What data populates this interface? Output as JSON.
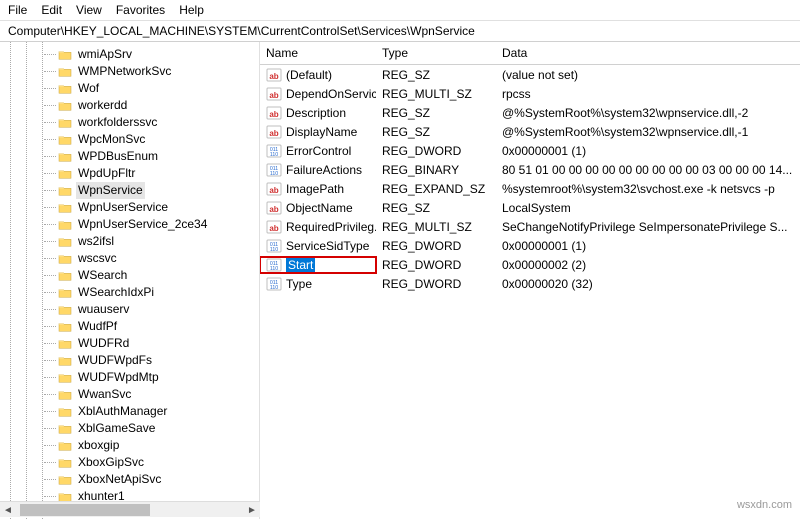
{
  "menu": {
    "items": [
      "File",
      "Edit",
      "View",
      "Favorites",
      "Help"
    ]
  },
  "path": "Computer\\HKEY_LOCAL_MACHINE\\SYSTEM\\CurrentControlSet\\Services\\WpnService",
  "tree": [
    {
      "label": "wmiApSrv",
      "selected": false
    },
    {
      "label": "WMPNetworkSvc",
      "selected": false
    },
    {
      "label": "Wof",
      "selected": false
    },
    {
      "label": "workerdd",
      "selected": false
    },
    {
      "label": "workfolderssvc",
      "selected": false
    },
    {
      "label": "WpcMonSvc",
      "selected": false
    },
    {
      "label": "WPDBusEnum",
      "selected": false
    },
    {
      "label": "WpdUpFltr",
      "selected": false
    },
    {
      "label": "WpnService",
      "selected": true
    },
    {
      "label": "WpnUserService",
      "selected": false
    },
    {
      "label": "WpnUserService_2ce34",
      "selected": false
    },
    {
      "label": "ws2ifsl",
      "selected": false
    },
    {
      "label": "wscsvc",
      "selected": false
    },
    {
      "label": "WSearch",
      "selected": false
    },
    {
      "label": "WSearchIdxPi",
      "selected": false
    },
    {
      "label": "wuauserv",
      "selected": false
    },
    {
      "label": "WudfPf",
      "selected": false
    },
    {
      "label": "WUDFRd",
      "selected": false
    },
    {
      "label": "WUDFWpdFs",
      "selected": false
    },
    {
      "label": "WUDFWpdMtp",
      "selected": false
    },
    {
      "label": "WwanSvc",
      "selected": false
    },
    {
      "label": "XblAuthManager",
      "selected": false
    },
    {
      "label": "XblGameSave",
      "selected": false
    },
    {
      "label": "xboxgip",
      "selected": false
    },
    {
      "label": "XboxGipSvc",
      "selected": false
    },
    {
      "label": "XboxNetApiSvc",
      "selected": false
    },
    {
      "label": "xhunter1",
      "selected": false
    }
  ],
  "columns": {
    "name": "Name",
    "type": "Type",
    "data": "Data"
  },
  "values": [
    {
      "name": "(Default)",
      "kind": "sz",
      "type": "REG_SZ",
      "data": "(value not set)",
      "selected": false
    },
    {
      "name": "DependOnService",
      "kind": "sz",
      "type": "REG_MULTI_SZ",
      "data": "rpcss",
      "selected": false
    },
    {
      "name": "Description",
      "kind": "sz",
      "type": "REG_SZ",
      "data": "@%SystemRoot%\\system32\\wpnservice.dll,-2",
      "selected": false
    },
    {
      "name": "DisplayName",
      "kind": "sz",
      "type": "REG_SZ",
      "data": "@%SystemRoot%\\system32\\wpnservice.dll,-1",
      "selected": false
    },
    {
      "name": "ErrorControl",
      "kind": "bin",
      "type": "REG_DWORD",
      "data": "0x00000001 (1)",
      "selected": false
    },
    {
      "name": "FailureActions",
      "kind": "bin",
      "type": "REG_BINARY",
      "data": "80 51 01 00 00 00 00 00 00 00 00 00 03 00 00 00 14...",
      "selected": false
    },
    {
      "name": "ImagePath",
      "kind": "sz",
      "type": "REG_EXPAND_SZ",
      "data": "%systemroot%\\system32\\svchost.exe -k netsvcs -p",
      "selected": false
    },
    {
      "name": "ObjectName",
      "kind": "sz",
      "type": "REG_SZ",
      "data": "LocalSystem",
      "selected": false
    },
    {
      "name": "RequiredPrivileg...",
      "kind": "sz",
      "type": "REG_MULTI_SZ",
      "data": "SeChangeNotifyPrivilege SeImpersonatePrivilege S...",
      "selected": false
    },
    {
      "name": "ServiceSidType",
      "kind": "bin",
      "type": "REG_DWORD",
      "data": "0x00000001 (1)",
      "selected": false
    },
    {
      "name": "Start",
      "kind": "bin",
      "type": "REG_DWORD",
      "data": "0x00000002 (2)",
      "selected": true
    },
    {
      "name": "Type",
      "kind": "bin",
      "type": "REG_DWORD",
      "data": "0x00000020 (32)",
      "selected": false
    }
  ],
  "watermark": "wsxdn.com"
}
